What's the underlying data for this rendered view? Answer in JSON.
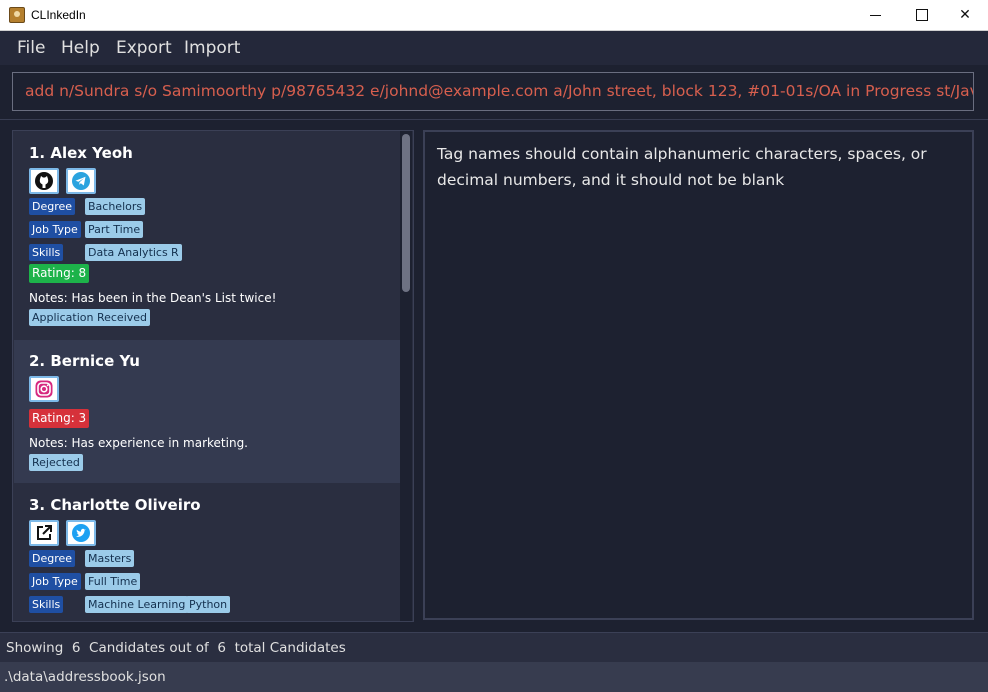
{
  "window": {
    "title": "CLInkedIn",
    "minimize": "",
    "maximize": "",
    "close": "✕"
  },
  "menu": {
    "items": [
      "File",
      "Help",
      "Export",
      "Import"
    ]
  },
  "command": {
    "value": "add n/Sundra s/o Samimoorthy p/98765432 e/johnd@example.com a/John street, block 123, #01-01s/OA in Progress st/Java dt/B"
  },
  "result": {
    "message": "Tag names should contain alphanumeric characters, spaces, or decimal numbers, and it should not be blank"
  },
  "candidates": [
    {
      "name": "1.  Alex Yeoh",
      "socials": [
        "github-icon",
        "telegram-icon"
      ],
      "degree_label": "Degree",
      "degree": "Bachelors",
      "jobtype_label": "Job Type",
      "jobtype": "Part Time",
      "skills_label": "Skills",
      "skills": [
        "Data Analytics",
        "R"
      ],
      "rating": "Rating: 8",
      "notes": "Notes: Has been in the Dean's List twice!",
      "status": "Application Received"
    },
    {
      "name": "2.  Bernice Yu",
      "socials": [
        "instagram-icon"
      ],
      "rating": "Rating: 3",
      "notes": "Notes: Has experience in marketing.",
      "status": "Rejected"
    },
    {
      "name": "3.  Charlotte Oliveiro",
      "socials": [
        "external-link-icon",
        "twitter-icon"
      ],
      "degree_label": "Degree",
      "degree": "Masters",
      "jobtype_label": "Job Type",
      "jobtype": "Full Time",
      "skills_label": "Skills",
      "skills": [
        "Machine Learning",
        "Python"
      ]
    }
  ],
  "status": {
    "showing": "Showing  6  Candidates out of  6  total Candidates",
    "file_path": ".\\data\\addressbook.json"
  },
  "colors": {
    "background": "#1d2130",
    "command_text": "#d75f4e",
    "rating_good": "#1db34a",
    "rating_bad": "#d6313a",
    "tag_category": "#1f4fa3",
    "tag_value": "#9bcbe9"
  }
}
